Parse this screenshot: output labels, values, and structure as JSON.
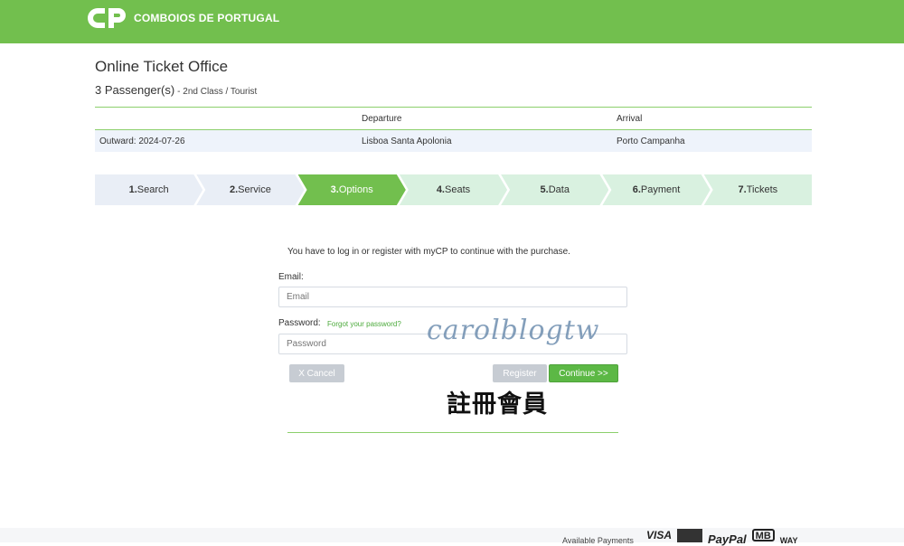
{
  "header": {
    "brand": "COMBOIOS DE PORTUGAL",
    "logo_icon": "cp-logo-icon",
    "bg_color": "#72bf4e"
  },
  "page": {
    "title": "Online Ticket Office",
    "passengers": "3 Passenger(s)",
    "travel_class": "- 2nd Class / Tourist"
  },
  "journey": {
    "headers": {
      "departure": "Departure",
      "arrival": "Arrival"
    },
    "outward": "Outward: 2024-07-26",
    "departure": "Lisboa Santa Apolonia",
    "arrival": "Porto Campanha"
  },
  "steps": [
    {
      "num": "1.",
      "label": "Search",
      "state": "done"
    },
    {
      "num": "2.",
      "label": "Service",
      "state": "done"
    },
    {
      "num": "3.",
      "label": "Options",
      "state": "active"
    },
    {
      "num": "4.",
      "label": "Seats",
      "state": "todo"
    },
    {
      "num": "5.",
      "label": "Data",
      "state": "todo"
    },
    {
      "num": "6.",
      "label": "Payment",
      "state": "todo"
    },
    {
      "num": "7.",
      "label": "Tickets",
      "state": "todo"
    }
  ],
  "login": {
    "notice": "You have to log in or register with myCP to continue with the purchase.",
    "email_label": "Email:",
    "email_placeholder": "Email",
    "password_label": "Password:",
    "forgot_link": "Forgot your password?",
    "password_placeholder": "Password",
    "cancel_label": "X Cancel",
    "register_label": "Register",
    "continue_label": "Continue >>"
  },
  "overlay": {
    "watermark": "carolblogtw",
    "caption": "註冊會員"
  },
  "footer": {
    "payments_label": "Available Payments",
    "payments": [
      "VISA",
      "PayPal",
      "MB",
      "WAY"
    ]
  }
}
